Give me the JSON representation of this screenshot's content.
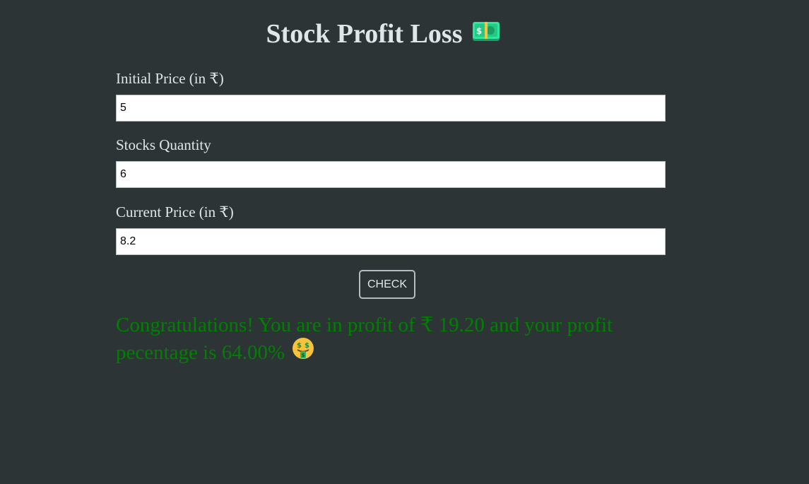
{
  "header": {
    "title": "Stock Profit Loss",
    "icon": "money-banknote-icon"
  },
  "form": {
    "initial_price": {
      "label": "Initial Price (in ₹)",
      "value": "5"
    },
    "quantity": {
      "label": "Stocks Quantity",
      "value": "6"
    },
    "current_price": {
      "label": "Current Price (in ₹)",
      "value": "8.2"
    },
    "check_label": "CHECK"
  },
  "result": {
    "message": "Congratulations! You are in profit of ₹ 19.20 and your profit pecentage is 64.00%",
    "icon": "money-mouth-face-icon",
    "color": "#008000"
  },
  "theme": {
    "background": "#2d3436",
    "text": "#dfe6e9"
  }
}
